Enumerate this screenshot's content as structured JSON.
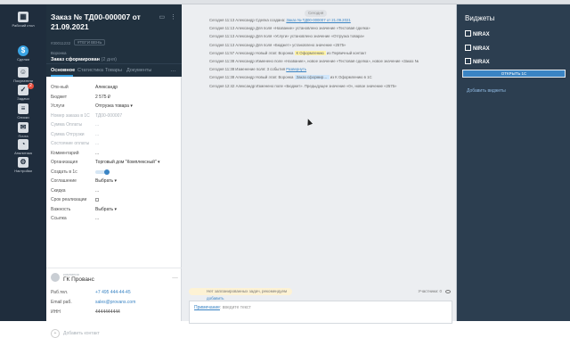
{
  "nav": [
    {
      "label": "Рабочий стол",
      "icon": "desk-icon"
    },
    {
      "label": "Сделки",
      "icon": "deals-icon"
    },
    {
      "label": "Покупатели",
      "icon": "buyers-icon"
    },
    {
      "label": "Задачи",
      "icon": "tasks-icon",
      "badge": "2"
    },
    {
      "label": "Списки",
      "icon": "lists-icon"
    },
    {
      "label": "Почта",
      "icon": "mail-icon"
    },
    {
      "label": "Аналитика",
      "icon": "analytics-icon"
    },
    {
      "label": "Настройки",
      "icon": "settings-icon"
    }
  ],
  "card": {
    "title": "Заказ № ТД00-000007 от 21.09.2021",
    "id": "#30011232",
    "tag": "#ТЕГИ ВЕНЬ",
    "funnel_label": "Воронка",
    "stage": "Заказ сформирован",
    "stage_sub": "(2 дня)",
    "head_icons": "▭ ⋮",
    "tabs": [
      "Основное",
      "Статистика",
      "Товары",
      "Документы"
    ],
    "tabs_more": "…"
  },
  "fields": [
    {
      "k": "Отв-ный",
      "v": "Александр"
    },
    {
      "k": "Бюджет",
      "v": "2 575 ₽"
    },
    {
      "k": "Услуги",
      "v": "Отгрузка товара ▾"
    },
    {
      "k": "Номер заказа в 1С",
      "v": "ТД00-000007",
      "dim": true
    },
    {
      "k": "Сумма Оплаты",
      "v": "...",
      "dim": true
    },
    {
      "k": "Сумма Отгрузки",
      "v": "...",
      "dim": true
    },
    {
      "k": "Состояние оплаты",
      "v": "...",
      "dim": true
    },
    {
      "k": "Комментарий",
      "v": "..."
    },
    {
      "k": "Организация",
      "v": "Торговый дом \"Комплексный\" ▾"
    },
    {
      "k": "Создать в 1с",
      "v": "",
      "type": "toggle"
    },
    {
      "k": "Соглашение",
      "v": "Выбрать ▾"
    },
    {
      "k": "Скидка",
      "v": "..."
    },
    {
      "k": "Срок реализации",
      "v": "",
      "type": "checkbox"
    },
    {
      "k": "Важность",
      "v": "Выбрать ▾"
    },
    {
      "k": "Ссылка",
      "v": "..."
    }
  ],
  "add_contact": "Добавить контакт",
  "company": {
    "small": "компания",
    "name": "ГК Прованс",
    "more": "⋯",
    "rows": [
      {
        "k": "Раб.тел.",
        "v": "+7 495 444-44-45",
        "link": true
      },
      {
        "k": "Email раб.",
        "v": "sales@provans.com",
        "link": true
      },
      {
        "k": "ИНН",
        "v": "4444444444"
      }
    ]
  },
  "feed": {
    "date": "Сегодня",
    "events": [
      {
        "parts": [
          {
            "t": "Сегодня 11:13 Александр Сделка создана: "
          },
          {
            "t": "Заказ № ТД00-000007 от 21.09.2021",
            "c": "lnk"
          }
        ]
      },
      {
        "parts": [
          {
            "t": "Сегодня 11:13 Александр Для поля «Название» установлено значение «Тестовая сделка»"
          }
        ]
      },
      {
        "parts": [
          {
            "t": "Сегодня 11:13 Александр Для поля «Услуги» установлено значение «Отгрузка товара»"
          }
        ]
      },
      {
        "parts": [
          {
            "t": "Сегодня 11:13 Александр Для поля «Бюджет» установлено значение «2575»"
          }
        ]
      },
      {
        "parts": [
          {
            "t": "Сегодня 11:57 Александр Новый этап:  Воронка "
          },
          {
            "t": "К Оформлению",
            "c": "hl"
          },
          {
            "t": "  из Первичный контакт"
          }
        ]
      },
      {
        "parts": [
          {
            "t": "Сегодня 11:38 Александр Изменено поле «Название», новое значение «Тестовая сделка», новое значение «Заказ №"
          }
        ]
      },
      {
        "parts": [
          {
            "t": "Сегодня 11:38 Изменение поля: 3 события "
          },
          {
            "t": "Развернуть",
            "c": "lnk"
          }
        ]
      },
      {
        "parts": [
          {
            "t": "Сегодня 11:38 Александр Новый этап:  Воронка "
          },
          {
            "t": "Заказ сформир…",
            "c": "hlb"
          },
          {
            "t": "  из К Оформлению в 1С"
          }
        ]
      },
      {
        "parts": [
          {
            "t": "Сегодня 12:42 Александр Изменено поле «Бюджет». Предыдущее значение «0», новое значение «2575»"
          }
        ]
      }
    ],
    "notice_text": "Нет запланированных задач, рекомендуем ",
    "notice_link": "добавить",
    "participants": "Участники: 0",
    "note_link": "Примечание",
    "note_placeholder": ": введите текст"
  },
  "widgets": {
    "title": "Виджеты",
    "items": [
      "NIRAX",
      "NIRAX",
      "NIRAX"
    ],
    "open_button": "ОТКРЫТЬ 1С",
    "add": "Добавить виджеты"
  }
}
